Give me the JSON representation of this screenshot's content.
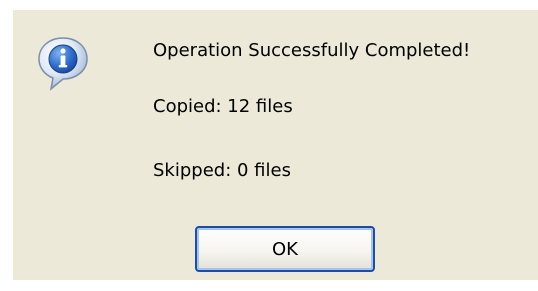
{
  "dialog": {
    "icon": "info-icon",
    "message": "Operation Successfully Completed!",
    "lines": [
      "Copied: 12 files",
      "Skipped: 0 files"
    ],
    "ok_label": "OK"
  },
  "colors": {
    "dialog_bg": "#ece9d8",
    "button_border": "#1c4ea8",
    "button_focus_ring": "#a9c3ef",
    "icon_blue": "#2f6fd0"
  }
}
